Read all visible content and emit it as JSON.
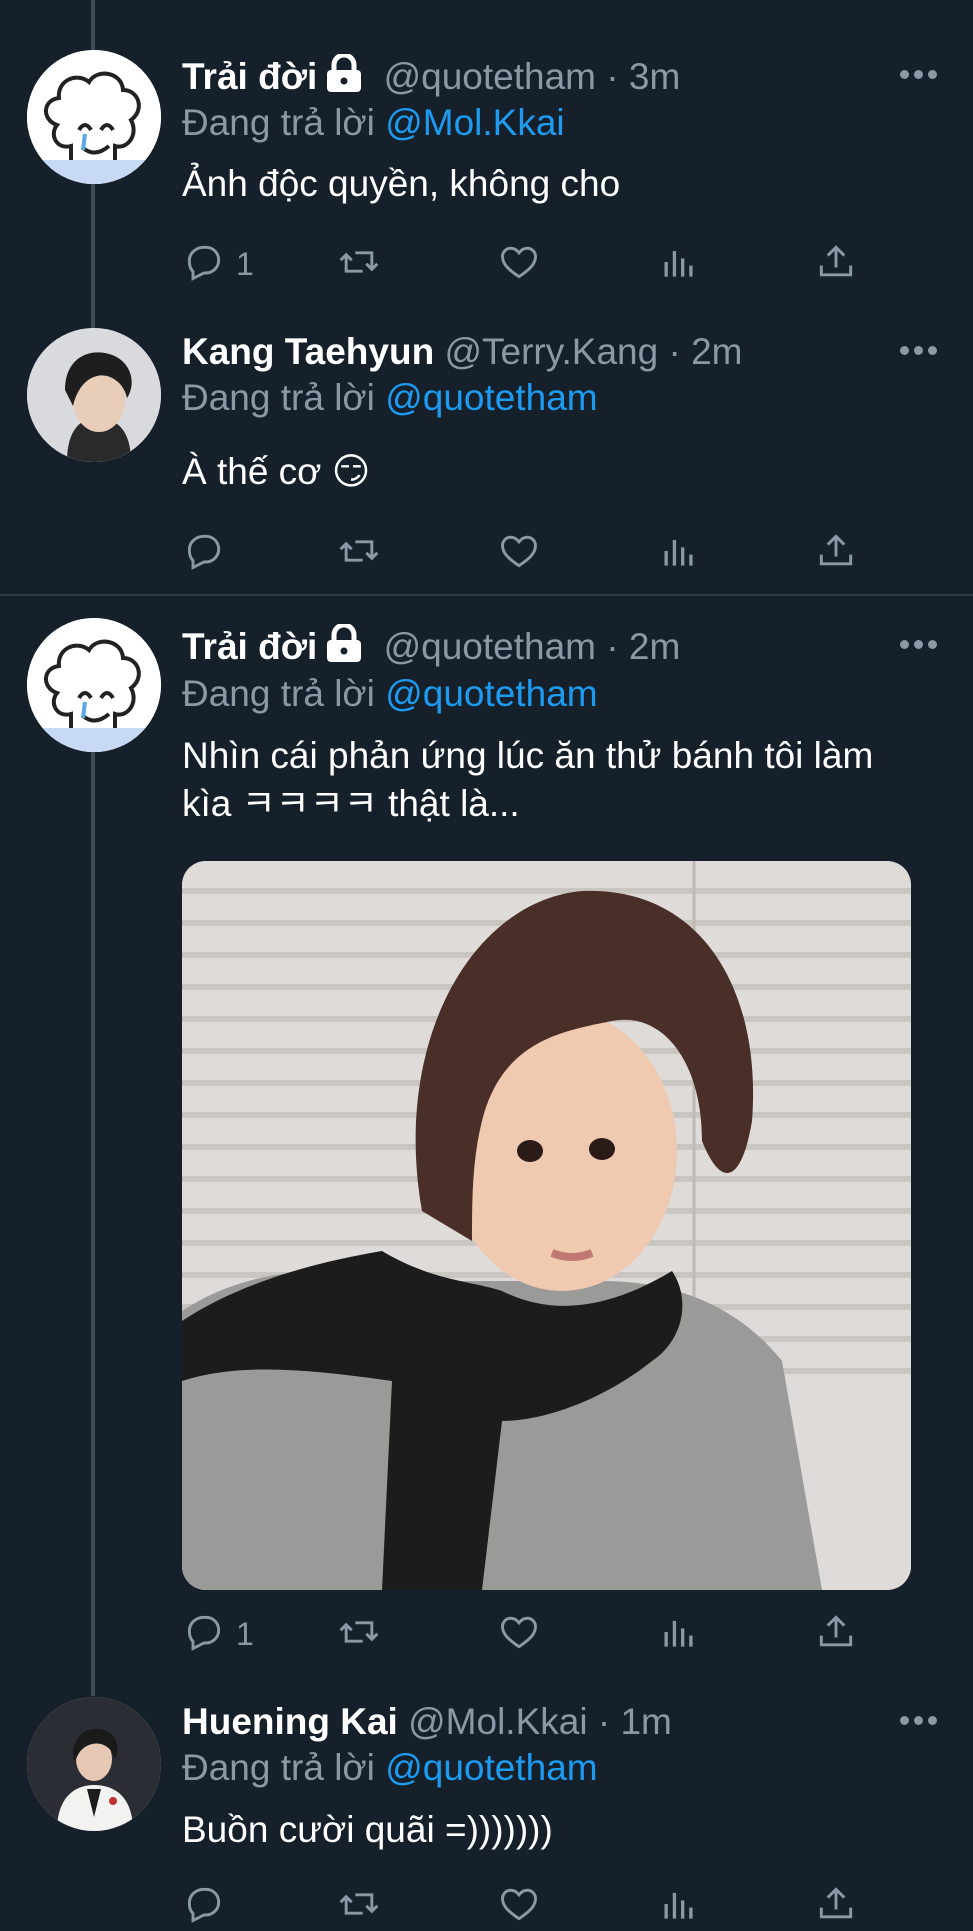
{
  "tweets": [
    {
      "name": "Trải đời",
      "handle": "@quotetham",
      "separator": "·",
      "time": "3m",
      "reply_label": "Đang trả lời",
      "reply_to": "@Mol.Kkai",
      "text": "Ảnh độc quyền, không cho",
      "reply_count": "1"
    },
    {
      "name": "Kang Taehyun",
      "handle": "@Terry.Kang",
      "separator": "·",
      "time": "2m",
      "reply_label": "Đang trả lời",
      "reply_to": "@quotetham",
      "text": "À thế cơ 😏",
      "reply_count": ""
    },
    {
      "name": "Trải đời",
      "handle": "@quotetham",
      "separator": "·",
      "time": "2m",
      "reply_label": "Đang trả lời",
      "reply_to": "@quotetham",
      "text_line1": "Nhìn cái phản ứng lúc ăn thử bánh tôi làm",
      "text_line2": "kìa ㅋㅋㅋㅋ thật là...",
      "reply_count": "1"
    },
    {
      "name": "Huening Kai",
      "handle": "@Mol.Kkai",
      "separator": "·",
      "time": "1m",
      "reply_label": "Đang trả lời",
      "reply_to": "@quotetham",
      "text": "Buồn cười quãi =)))))))",
      "reply_count": ""
    }
  ],
  "colors": {
    "background": "#15202b",
    "secondary_text": "#8b98a5",
    "mention": "#1d9bf0",
    "divider": "#2f3b47"
  },
  "icons": [
    "reply-icon",
    "retweet-icon",
    "like-icon",
    "analytics-icon",
    "share-icon",
    "lock-icon",
    "more-icon"
  ]
}
